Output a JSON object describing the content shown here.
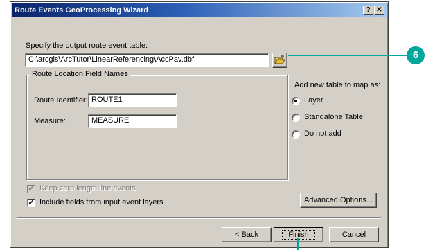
{
  "window": {
    "title": "Route Events GeoProcessing Wizard",
    "help_button": "?",
    "close_button": "✕"
  },
  "output": {
    "label": "Specify the output route event table:",
    "path": "C:\\arcgis\\ArcTutor\\LinearReferencing\\AccPav.dbf",
    "browse_icon": "open-folder-icon"
  },
  "route_location": {
    "group_label": "Route Location Field Names",
    "route_identifier_label": "Route Identifier:",
    "route_identifier_value": "ROUTE1",
    "measure_label": "Measure:",
    "measure_value": "MEASURE"
  },
  "add_table": {
    "label": "Add new table to map as:",
    "options": [
      "Layer",
      "Standalone Table",
      "Do not add"
    ],
    "selected": "Layer"
  },
  "options": {
    "keep_zero_length_label": "Keep zero length line events",
    "keep_zero_length_checked": true,
    "keep_zero_length_enabled": false,
    "include_fields_label": "Include fields from input event layers",
    "include_fields_checked": true,
    "advanced_label": "Advanced Options..."
  },
  "footer": {
    "back_label": "< Back",
    "finish_label": "Finish",
    "cancel_label": "Cancel"
  },
  "callout": {
    "number": "6",
    "color": "#00a79d"
  }
}
